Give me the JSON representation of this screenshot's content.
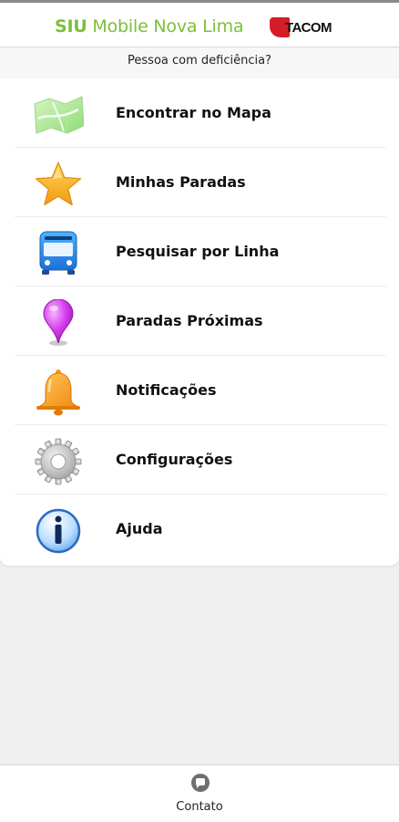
{
  "header": {
    "title_bold": "SIU",
    "title_rest": " Mobile Nova Lima",
    "brand": "TACOM",
    "title_color": "#7cbf3a"
  },
  "accessibility": {
    "label": "Pessoa com deficiência?"
  },
  "menu": {
    "items": [
      {
        "label": "Encontrar no Mapa",
        "icon": "map-icon"
      },
      {
        "label": "Minhas Paradas",
        "icon": "star-icon"
      },
      {
        "label": "Pesquisar por Linha",
        "icon": "bus-icon"
      },
      {
        "label": "Paradas Próximas",
        "icon": "location-pin-icon"
      },
      {
        "label": "Notificações",
        "icon": "bell-icon"
      },
      {
        "label": "Configurações",
        "icon": "gear-icon"
      },
      {
        "label": "Ajuda",
        "icon": "info-icon"
      }
    ]
  },
  "footer": {
    "contact_label": "Contato",
    "contact_icon": "chat-bubble-icon"
  }
}
